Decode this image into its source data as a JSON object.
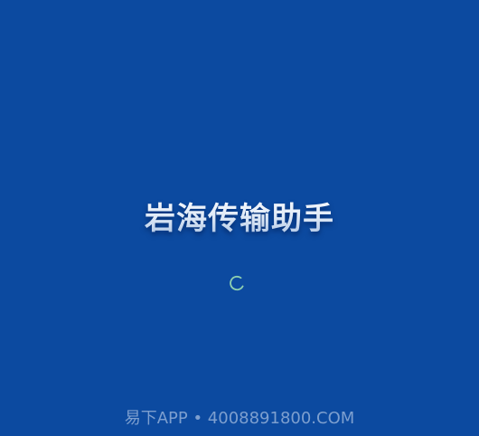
{
  "splash": {
    "title": "岩海传输助手",
    "footer": "易下APP • 4008891800.COM",
    "loading_icon": "loading-spinner-icon"
  },
  "colors": {
    "background": "#0c4aa0",
    "title_top": "#ffffff",
    "title_bottom": "#a8c1e3",
    "spinner": "#8fd0b0",
    "footer": "#7d9fcf"
  }
}
